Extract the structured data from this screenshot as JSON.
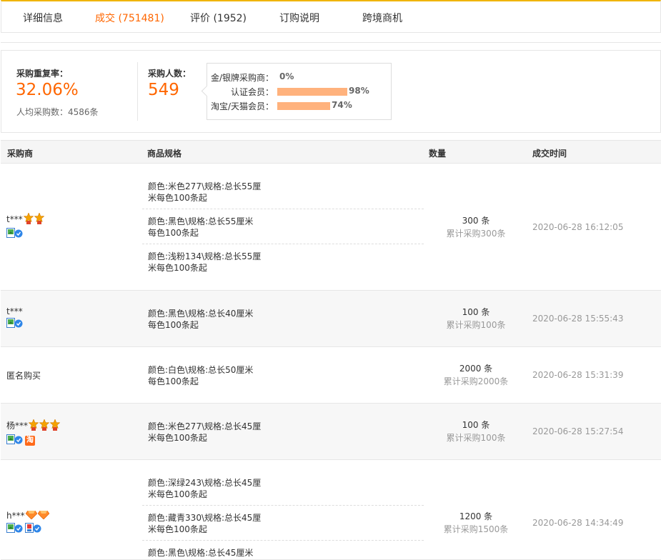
{
  "tabs": [
    {
      "label": "详细信息"
    },
    {
      "label": "成交 (751481)"
    },
    {
      "label": "评价 (1952)"
    },
    {
      "label": "订购说明"
    },
    {
      "label": "跨境商机"
    }
  ],
  "summary": {
    "repeat_label": "采购重复率：",
    "repeat_value": "32.06%",
    "avg_label": "人均采购数：4586条",
    "buyers_label": "采购人数：",
    "buyers_value": "549",
    "popup": [
      {
        "label": "金/银牌采购商：",
        "value": "0%",
        "percent": 0
      },
      {
        "label": "认证会员：",
        "value": "98%",
        "percent": 98
      },
      {
        "label": "淘宝/天猫会员：",
        "value": "74%",
        "percent": 74
      }
    ]
  },
  "table": {
    "headers": [
      "采购商",
      "商品规格",
      "数量",
      "成交时间"
    ],
    "rows": [
      {
        "buyer": "t***",
        "badges": {
          "star": 2
        },
        "specs": [
          "颜色:米色277\\规格:总长55厘\n米每色100条起",
          "颜色:黑色\\规格:总长55厘米\n每色100条起",
          "颜色:浅粉134\\规格:总长55厘\n米每色100条起"
        ],
        "qty": "300 条",
        "cumulative": "累计采购300条",
        "time": "2020-06-28 16:12:05"
      },
      {
        "buyer": "t***",
        "badges": {},
        "specs": [
          "颜色:黑色\\规格:总长40厘米\n每色100条起"
        ],
        "qty": "100 条",
        "cumulative": "累计采购100条",
        "time": "2020-06-28 15:55:43"
      },
      {
        "buyer": "匿名购买",
        "badges": {},
        "specs": [
          "颜色:白色\\规格:总长50厘米\n每色100条起"
        ],
        "qty": "2000 条",
        "cumulative": "累计采购2000条",
        "time": "2020-06-28 15:31:39"
      },
      {
        "buyer": "杨***",
        "badges": {
          "star": 3
        },
        "tao_label": "淘",
        "specs": [
          "颜色:米色277\\规格:总长45厘\n米每色100条起"
        ],
        "qty": "100 条",
        "cumulative": "累计采购100条",
        "time": "2020-06-28 15:27:54"
      },
      {
        "buyer": "h***",
        "badges": {
          "diamond": 2
        },
        "specs": [
          "颜色:深绿243\\规格:总长45厘\n米每色100条起",
          "颜色:藏青330\\规格:总长45厘\n米每色100条起",
          "颜色:黑色\\规格:总长45厘米"
        ],
        "qty": "1200 条",
        "cumulative": "累计采购1500条",
        "time": "2020-06-28 14:34:49"
      }
    ]
  },
  "colors": {
    "accent": "#ff6600",
    "bar": "#ffb27d",
    "tab_border": "#f0b400"
  }
}
